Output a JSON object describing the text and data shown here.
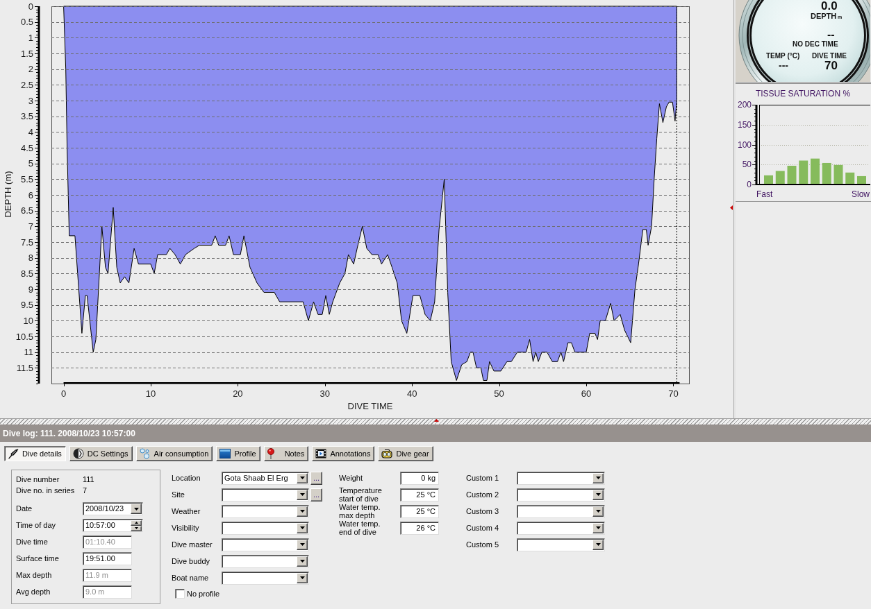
{
  "depth_chart": {
    "chart_data": {
      "type": "area",
      "xlabel": "DIVE TIME",
      "ylabel": "DEPTH (m)",
      "x": [
        0,
        0.25,
        0.4,
        0.65,
        1.3,
        2.1,
        2.5,
        2.7,
        3.4,
        3.7,
        4.4,
        4.8,
        5.1,
        5.7,
        6.1,
        6.5,
        7.0,
        7.5,
        8.1,
        8.6,
        10.0,
        10.4,
        10.8,
        11.8,
        12.2,
        12.8,
        13.4,
        14.0,
        15.0,
        15.6,
        17.0,
        17.4,
        17.8,
        18.6,
        19.0,
        19.5,
        20.3,
        20.7,
        21.4,
        22.2,
        23.0,
        24.2,
        24.8,
        27.5,
        28.1,
        28.7,
        29.2,
        29.7,
        30.1,
        30.5,
        30.9,
        31.7,
        32.3,
        32.7,
        33.3,
        33.7,
        34.3,
        34.8,
        35.4,
        36.1,
        36.5,
        37.2,
        37.7,
        38.3,
        38.8,
        39.4,
        40.1,
        40.9,
        41.5,
        42.1,
        42.6,
        43.1,
        43.7,
        44.1,
        44.5,
        45.1,
        45.7,
        46.3,
        46.7,
        47.0,
        47.4,
        47.9,
        48.2,
        48.6,
        48.9,
        49.4,
        50.2,
        50.9,
        51.4,
        52.1,
        53.1,
        53.5,
        53.9,
        54.2,
        54.5,
        54.9,
        55.5,
        56.1,
        56.7,
        57.1,
        57.4,
        57.9,
        58.3,
        58.7,
        60.0,
        60.4,
        61.0,
        61.3,
        61.6,
        62.2,
        62.8,
        63.2,
        63.9,
        64.4,
        65.1,
        65.6,
        66.0,
        66.5,
        66.9,
        67.1,
        67.5,
        67.8,
        68.1,
        68.4,
        68.8,
        69.2,
        69.5,
        69.9,
        70.2,
        70.4
      ],
      "series": [
        {
          "color": "#8c8ef0",
          "values": [
            0,
            2,
            4.5,
            7.3,
            7.3,
            10.4,
            9.2,
            9.2,
            11.0,
            10.6,
            7.0,
            8.3,
            8.5,
            6.4,
            8.3,
            8.8,
            8.6,
            8.8,
            7.7,
            8.2,
            8.2,
            8.5,
            7.9,
            7.9,
            7.7,
            7.9,
            8.2,
            7.9,
            7.7,
            7.6,
            7.6,
            7.3,
            7.6,
            7.6,
            7.3,
            7.9,
            7.9,
            7.3,
            8.3,
            8.8,
            9.1,
            9.1,
            9.4,
            9.4,
            10.0,
            9.4,
            9.8,
            9.8,
            9.2,
            9.8,
            9.4,
            8.8,
            8.5,
            7.9,
            8.2,
            7.7,
            7.0,
            7.7,
            7.9,
            7.9,
            8.2,
            7.9,
            8.3,
            8.8,
            10.0,
            10.4,
            9.2,
            9.2,
            9.8,
            10.0,
            9.4,
            7.1,
            5.5,
            9.1,
            11.3,
            11.9,
            11.4,
            11.3,
            11.0,
            11.0,
            11.5,
            11.5,
            11.9,
            11.9,
            11.3,
            11.6,
            11.6,
            11.3,
            11.3,
            11.0,
            11.0,
            10.6,
            11.3,
            11.0,
            11.3,
            11.0,
            11.0,
            11.3,
            11.3,
            11.0,
            11.3,
            10.7,
            10.7,
            11.0,
            11.0,
            10.4,
            10.4,
            10.6,
            10.0,
            10.0,
            9.45,
            10.0,
            9.8,
            10.3,
            10.7,
            9.0,
            8.2,
            7.1,
            7.1,
            7.6,
            7.0,
            5.5,
            4.2,
            3.1,
            3.7,
            3.2,
            3.05,
            3.05,
            3.65,
            3.0
          ]
        }
      ],
      "xlim": [
        -1.4,
        71.8
      ],
      "ylim": [
        12,
        0
      ],
      "xticks": [
        0,
        10,
        20,
        30,
        40,
        50,
        60,
        70
      ],
      "yticks": [
        0,
        0.5,
        1,
        1.5,
        2,
        2.5,
        3,
        3.5,
        4,
        4.5,
        5,
        5.5,
        6,
        6.5,
        7,
        7.5,
        8,
        8.5,
        9,
        9.5,
        10,
        10.5,
        11,
        11.5
      ],
      "grid": true,
      "ref_lines": [
        {
          "axis": "x",
          "value": 70.4
        }
      ]
    }
  },
  "gauge": {
    "depth": "0.0",
    "depth_label": "DEPTH",
    "depth_unit": "m",
    "no_dec_time": "--",
    "no_dec_time_label": "NO DEC TIME",
    "temp_label": "TEMP (°C)",
    "dive_time_label": "DIVE TIME",
    "temp": "---",
    "dive_time": "70"
  },
  "tissue_saturation": {
    "chart_data": {
      "type": "bar",
      "title": "TISSUE SATURATION %",
      "series": [
        {
          "color": "#86bb5c",
          "values": [
            23,
            34,
            47,
            60,
            65,
            54,
            49,
            30,
            21
          ]
        }
      ],
      "ylim": [
        0,
        200
      ],
      "yticks": [
        0,
        50,
        100,
        150,
        200
      ],
      "grid": true,
      "annotations": [
        "Fast",
        "Slow"
      ]
    }
  },
  "log_title": "Dive log: 111. 2008/10/23 10:57:00",
  "tabs": [
    {
      "label": "Dive details",
      "selected": true
    },
    {
      "label": "DC Settings",
      "selected": false
    },
    {
      "label": "Air consumption",
      "selected": false
    },
    {
      "label": "Profile",
      "selected": false
    },
    {
      "label": "Notes",
      "selected": false
    },
    {
      "label": "Annotations",
      "selected": false
    },
    {
      "label": "Dive gear",
      "selected": false
    }
  ],
  "dive_info": {
    "rows": [
      {
        "label": "Dive number",
        "value": "111"
      },
      {
        "label": "Dive no. in series",
        "value": "7"
      }
    ],
    "fields": [
      {
        "label": "Date",
        "kind": "date",
        "value": "2008/10/23",
        "disabled": false
      },
      {
        "label": "Time of day",
        "kind": "time",
        "value": "10:57:00",
        "disabled": false
      },
      {
        "label": "Dive time",
        "kind": "text",
        "value": "01:10.40",
        "disabled": true
      },
      {
        "label": "Surface time",
        "kind": "text",
        "value": "19:51.00",
        "disabled": false
      },
      {
        "label": "Max depth",
        "kind": "text",
        "value": "11.9 m",
        "disabled": true
      },
      {
        "label": "Avg depth",
        "kind": "text",
        "value": "9.0 m",
        "disabled": true
      }
    ]
  },
  "place_fields": [
    {
      "label": "Location",
      "value": "Gota Shaab El Erg",
      "browse_button": "..."
    },
    {
      "label": "Site",
      "browse_button": "..."
    },
    {
      "label": "Weather"
    },
    {
      "label": "Visibility"
    },
    {
      "label": "Dive master"
    },
    {
      "label": "Dive buddy"
    },
    {
      "label": "Boat name"
    }
  ],
  "no_profile": {
    "label": "No profile",
    "checked": false
  },
  "temperature_fields": [
    {
      "label": "Weight",
      "value": "0 kg"
    },
    {
      "label": "Temperature start of dive",
      "value": "25 °C"
    },
    {
      "label": "Water temp. max depth",
      "value": "25 °C"
    },
    {
      "label": "Water temp. end of dive",
      "value": "26 °C"
    }
  ],
  "custom_fields": [
    {
      "label": "Custom 1"
    },
    {
      "label": "Custom 2"
    },
    {
      "label": "Custom 3"
    },
    {
      "label": "Custom 4"
    },
    {
      "label": "Custom 5"
    }
  ]
}
